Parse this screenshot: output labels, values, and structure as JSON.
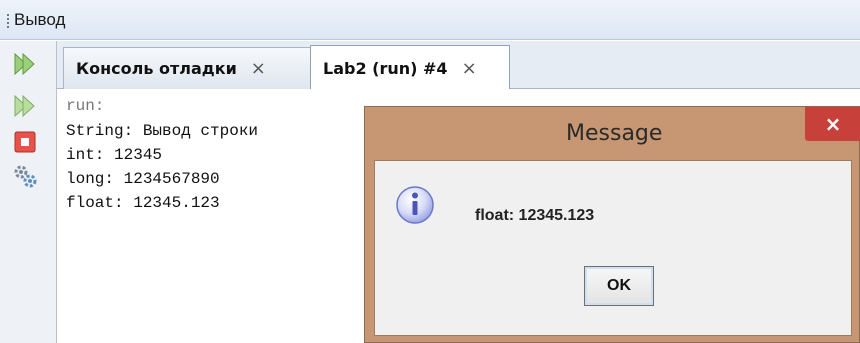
{
  "panel": {
    "title": "Вывод"
  },
  "tabs": [
    {
      "label": "Консоль отладки",
      "close": "×",
      "active": false
    },
    {
      "label": "Lab2 (run) #4",
      "close": "×",
      "active": true
    }
  ],
  "console": {
    "lines": [
      "run:",
      "String: Вывод строки",
      "int: 12345",
      "long: 1234567890",
      "float: 12345.123"
    ]
  },
  "dialog": {
    "title": "Message",
    "close": "×",
    "message": "float: 12345.123",
    "ok_label": "OK"
  },
  "icons": {
    "rerun": "rerun-icon",
    "rerun_alt": "rerun-alt-icon",
    "stop": "stop-icon",
    "settings": "settings-icon",
    "info": "info-icon"
  },
  "colors": {
    "dialog_frame": "#c69772",
    "dialog_close": "#c8403a",
    "header_bg": "#e6ecf4"
  }
}
